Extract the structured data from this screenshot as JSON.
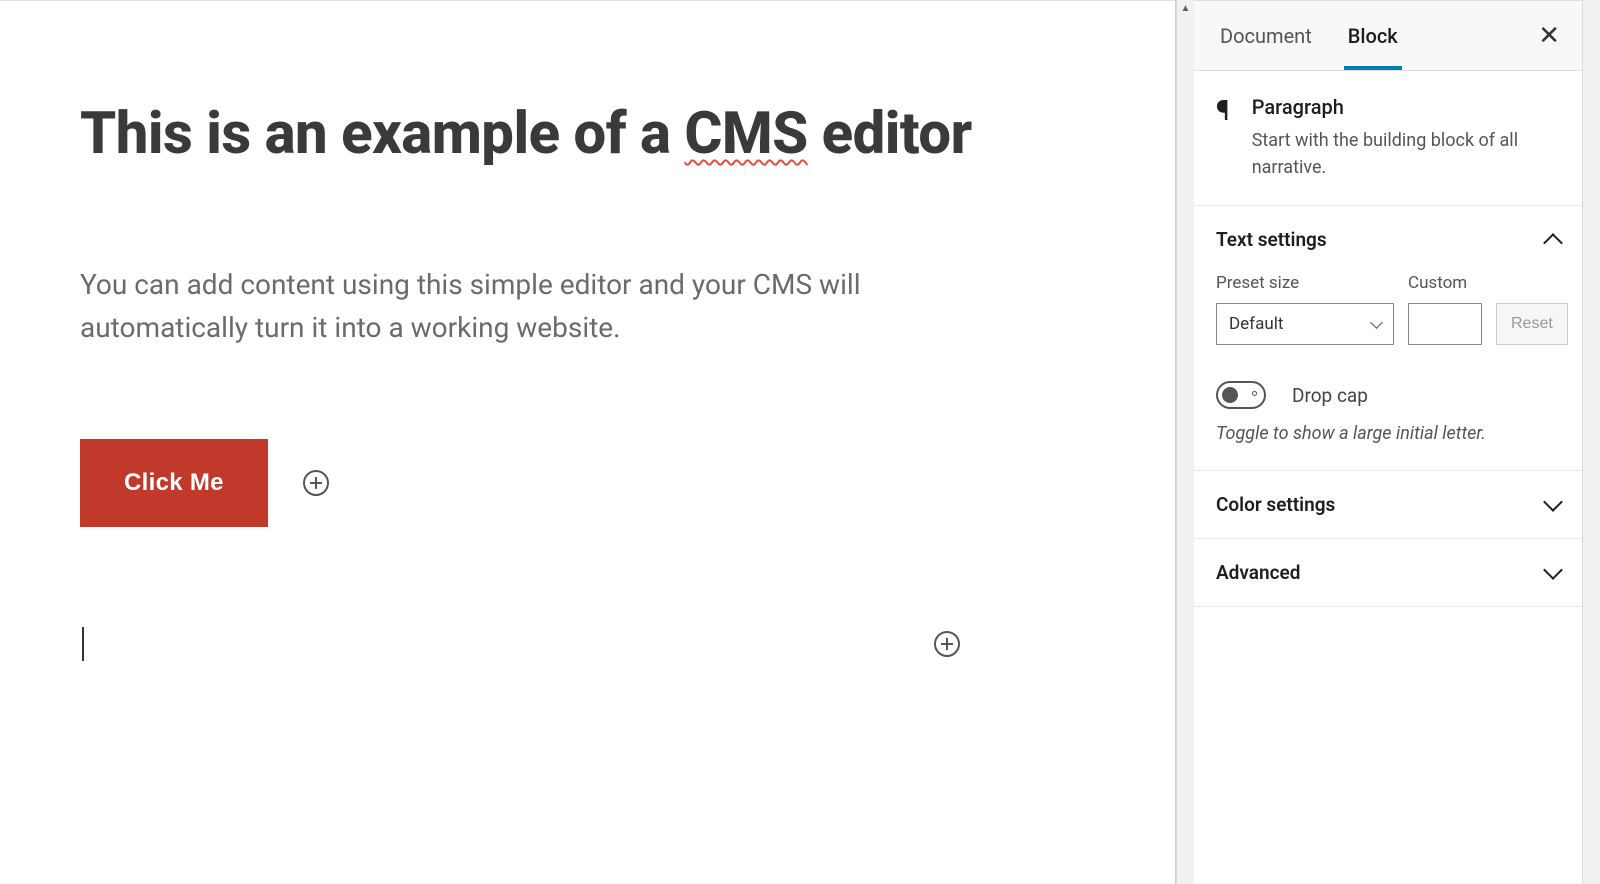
{
  "editor": {
    "title_prefix": "This is an example of a ",
    "title_highlight": "CMS",
    "title_suffix": " editor",
    "paragraph": "You can add content using this simple editor and your CMS will automatically turn it into a working website.",
    "button_label": "Click Me"
  },
  "sidebar": {
    "tabs": {
      "document": "Document",
      "block": "Block"
    },
    "block_info": {
      "title": "Paragraph",
      "description": "Start with the building block of all narrative."
    },
    "panels": {
      "text_settings": {
        "header": "Text settings",
        "preset_label": "Preset size",
        "preset_value": "Default",
        "custom_label": "Custom",
        "custom_value": "",
        "reset_label": "Reset",
        "dropcap_label": "Drop cap",
        "dropcap_help": "Toggle to show a large initial letter."
      },
      "color_settings": {
        "header": "Color settings"
      },
      "advanced": {
        "header": "Advanced"
      }
    }
  }
}
